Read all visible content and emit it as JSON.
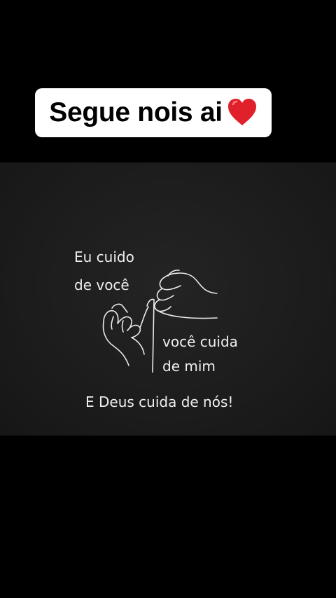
{
  "caption": {
    "text": "Segue nois ai",
    "emoji_icon": "red-heart-icon",
    "heart_color": "#e0202a"
  },
  "card": {
    "line1": "Eu cuido",
    "line2": "de você",
    "line3": "você cuida",
    "line4": "de mim",
    "line5": "E Deus cuida de nós!",
    "illustration_icon": "pinky-promise-hands-icon"
  }
}
